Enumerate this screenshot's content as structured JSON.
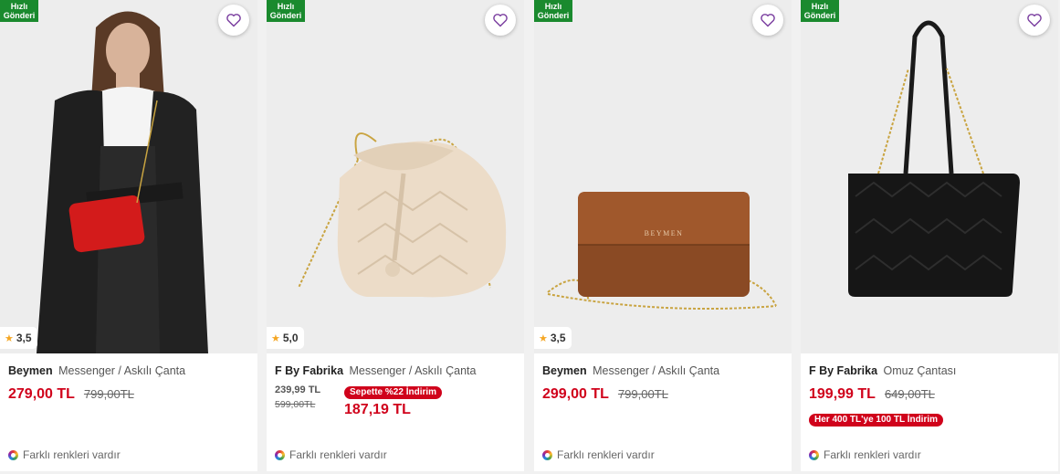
{
  "products": [
    {
      "fast_line1": "Hızlı",
      "fast_line2": "Gönderi",
      "rating": "3,5",
      "brand": "Beymen",
      "category": "Messenger / Askılı Çanta",
      "price": "279,00 TL",
      "old_price": "799,00TL",
      "colors_text": "Farklı renkleri vardır",
      "image": "model-with-red-bag"
    },
    {
      "fast_line1": "Hızlı",
      "fast_line2": "Gönderi",
      "rating": "5,0",
      "brand": "F By Fabrika",
      "category": "Messenger / Askılı Çanta",
      "price": "239,99 TL",
      "old_price": "599,00TL",
      "basket_badge": "Sepette %22 İndirim",
      "basket_price": "187,19 TL",
      "colors_text": "Farklı renkleri vardır",
      "image": "cream-bucket-bag"
    },
    {
      "fast_line1": "Hızlı",
      "fast_line2": "Gönderi",
      "rating": "3,5",
      "brand": "Beymen",
      "category": "Messenger / Askılı Çanta",
      "price": "299,00 TL",
      "old_price": "799,00TL",
      "colors_text": "Farklı renkleri vardır",
      "image": "brown-clutch",
      "bag_logo": "BEYMEN"
    },
    {
      "fast_line1": "Hızlı",
      "fast_line2": "Gönderi",
      "brand": "F By Fabrika",
      "category": "Omuz Çantası",
      "price": "199,99 TL",
      "old_price": "649,00TL",
      "promo_badge": "Her 400 TL'ye 100 TL İndirim",
      "colors_text": "Farklı renkleri vardır",
      "image": "black-tote-bag"
    }
  ],
  "colors": {
    "accent_red": "#d0021b",
    "fast_green": "#1a8a2e",
    "heart_purple": "#7b3fa0"
  },
  "icons": [
    "heart-icon",
    "star-icon",
    "color-wheel-icon"
  ]
}
